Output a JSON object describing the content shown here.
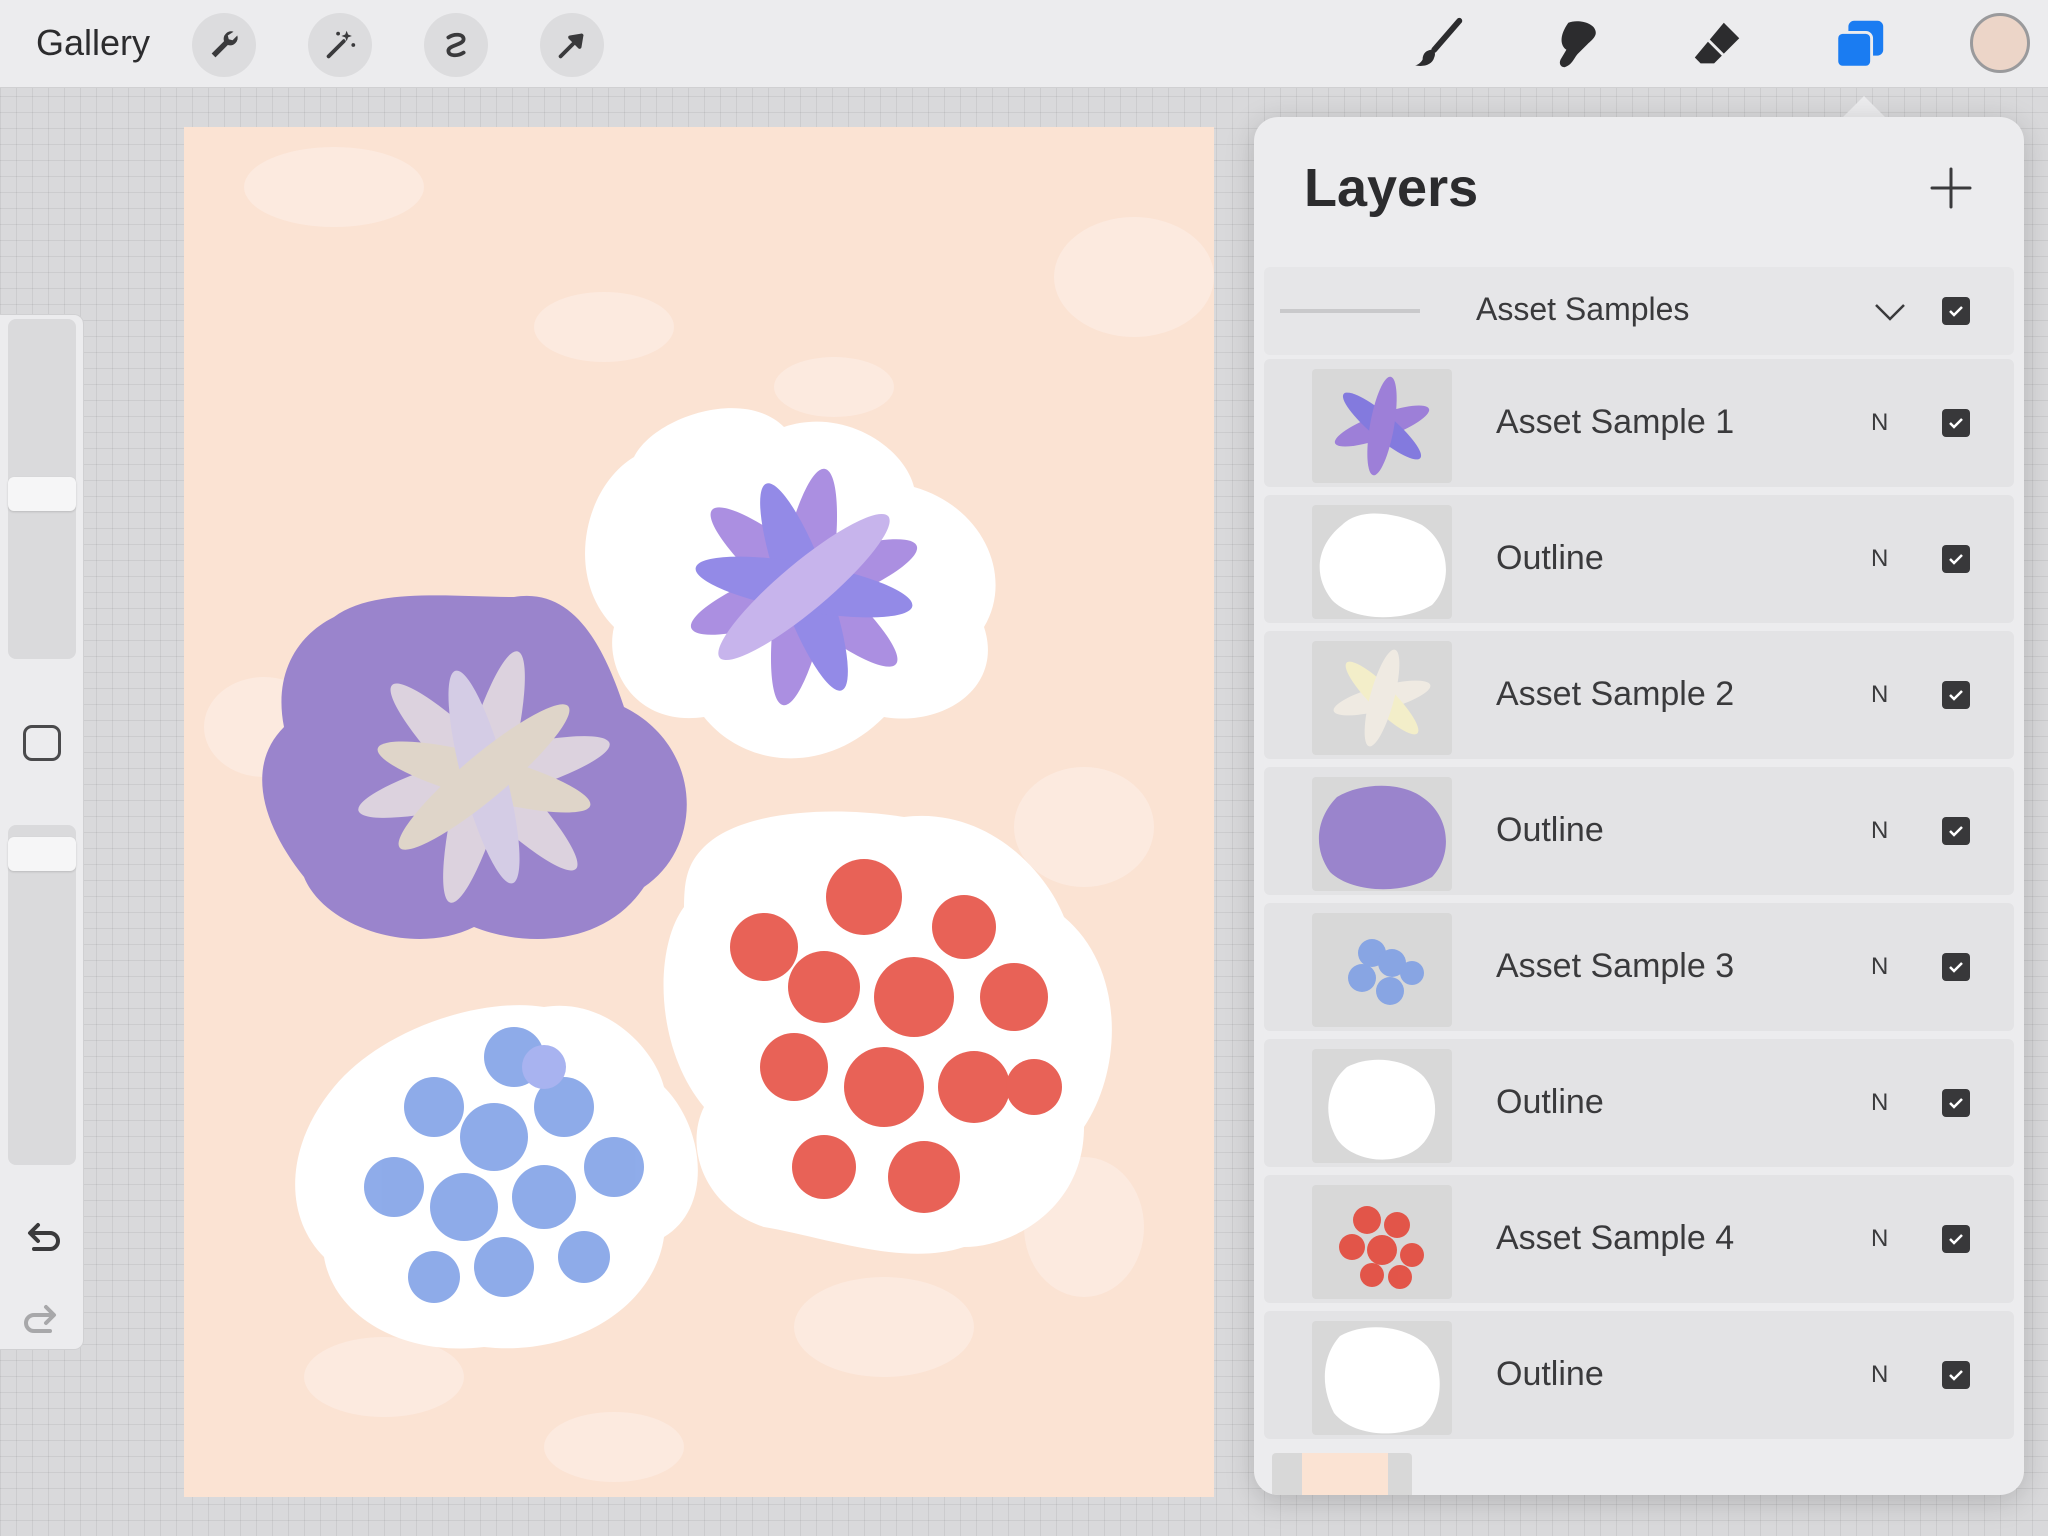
{
  "toolbar": {
    "gallery_label": "Gallery",
    "left_tools": [
      "wrench-icon",
      "magic-wand-icon",
      "selection-icon",
      "transform-arrow-icon"
    ],
    "right_tools": [
      "brush-icon",
      "smudge-icon",
      "eraser-icon",
      "layers-icon"
    ],
    "active_tool": "layers-icon",
    "current_color": "#ecd5c8",
    "accent_color": "#1a7cf2"
  },
  "sidebar": {
    "tools": [
      "brush-size-slider",
      "modify-button",
      "opacity-slider",
      "undo-icon",
      "redo-icon"
    ]
  },
  "canvas": {
    "background_color": "#fbe3d3",
    "stickers": [
      "purple-flower-on-white",
      "white-flower-on-purple",
      "red-flowers-on-white",
      "blue-flowers-on-white"
    ]
  },
  "layers_panel": {
    "title": "Layers",
    "group": {
      "name": "Asset Samples",
      "expanded": true,
      "visible": true
    },
    "layers": [
      {
        "name": "Asset Sample 1",
        "mode": "N",
        "visible": true
      },
      {
        "name": "Outline",
        "mode": "N",
        "visible": true
      },
      {
        "name": "Asset Sample 2",
        "mode": "N",
        "visible": true
      },
      {
        "name": "Outline",
        "mode": "N",
        "visible": true
      },
      {
        "name": "Asset Sample 3",
        "mode": "N",
        "visible": true
      },
      {
        "name": "Outline",
        "mode": "N",
        "visible": true
      },
      {
        "name": "Asset Sample 4",
        "mode": "N",
        "visible": true
      },
      {
        "name": "Outline",
        "mode": "N",
        "visible": true
      }
    ]
  }
}
